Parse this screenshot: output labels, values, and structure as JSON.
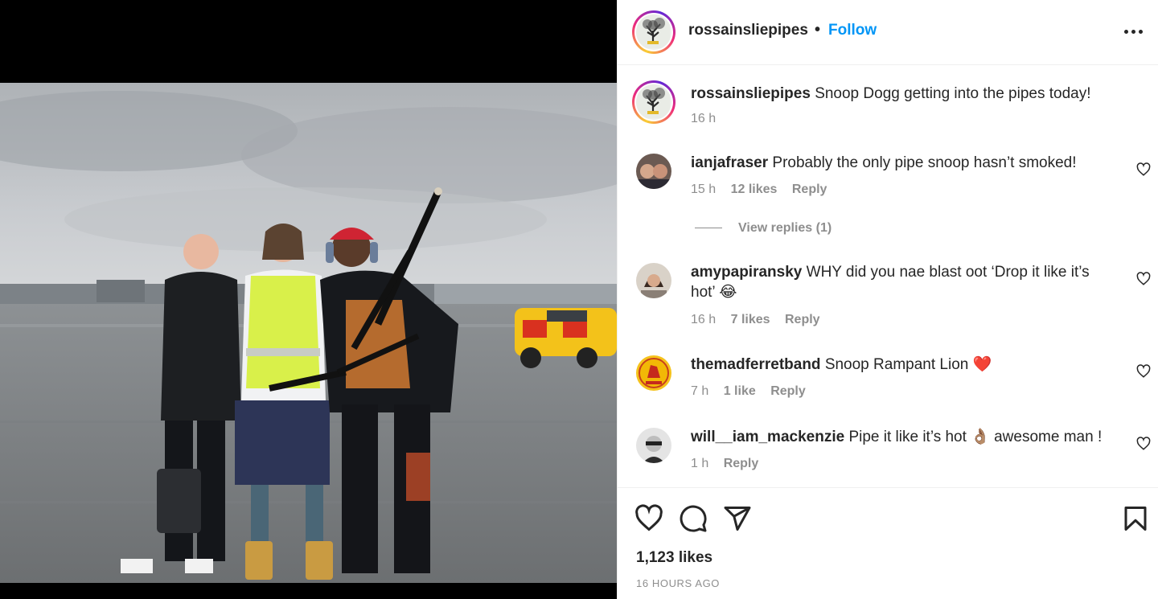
{
  "post": {
    "username": "rossainsliepipes",
    "follow_label": "Follow",
    "separator": "•",
    "photo_alt": "Three men on an airport apron, one playing bagpipes"
  },
  "caption": {
    "username": "rossainsliepipes",
    "text": "Snoop Dogg getting into the pipes today!",
    "time": "16 h"
  },
  "comments": [
    {
      "username": "ianjafraser",
      "text": "Probably the only pipe snoop hasn’t smoked!",
      "time": "15 h",
      "likes": "12 likes",
      "reply": "Reply"
    },
    {
      "username": "amypapiransky",
      "text": "WHY did you nae blast oot ‘Drop it like it’s hot’ 😂",
      "time": "16 h",
      "likes": "7 likes",
      "reply": "Reply"
    },
    {
      "username": "themadferretband",
      "text": "Snoop Rampant Lion ❤️",
      "time": "7 h",
      "likes": "1 like",
      "reply": "Reply"
    },
    {
      "username": "will__iam_mackenzie",
      "text": "Pipe it like it’s hot 👌🏽 awesome man !",
      "time": "1 h",
      "likes": "",
      "reply": "Reply"
    }
  ],
  "view_replies": "View replies (1)",
  "actions": {
    "like_icon": "heart-icon",
    "comment_icon": "comment-icon",
    "share_icon": "send-icon",
    "save_icon": "bookmark-icon"
  },
  "likes_count": "1,123 likes",
  "posted_ago": "16 HOURS AGO",
  "colors": {
    "link": "#0095f6",
    "text": "#262626",
    "muted": "#8e8e8e",
    "heart_red": "#ed4956"
  }
}
